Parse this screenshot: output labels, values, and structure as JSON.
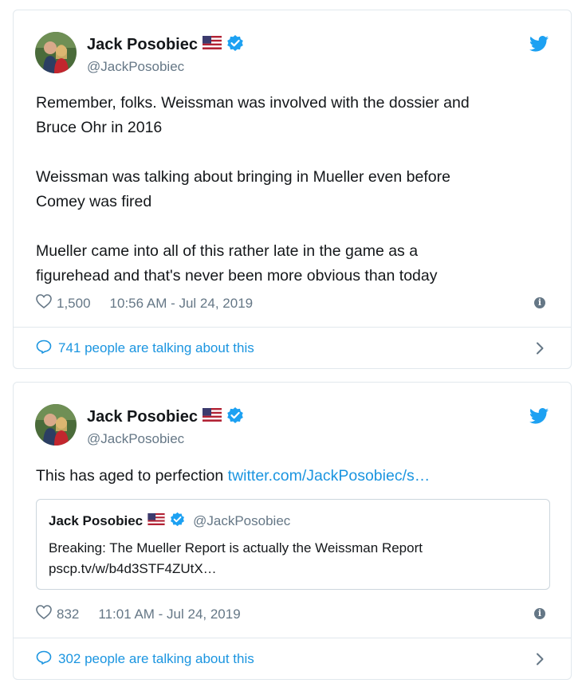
{
  "colors": {
    "link": "#1b95e0",
    "secondary_text": "#657786",
    "border": "#e1e8ed",
    "twitter_blue": "#1da1f2"
  },
  "tweets": [
    {
      "author_name": "Jack Posobiec",
      "author_handle": "@JackPosobiec",
      "flag_icon": "us-flag-icon",
      "verified_icon": "verified-badge-icon",
      "brand_icon": "twitter-bird-icon",
      "text_paragraphs": [
        [
          "Remember, folks. Weissman was involved with the dossier and",
          "Bruce Ohr in 2016"
        ],
        [
          "Weissman was talking about bringing in Mueller even before",
          "Comey was fired"
        ],
        [
          "Mueller came into all of this rather late in the game as a",
          "figurehead and that's never been more obvious than today"
        ]
      ],
      "likes": "1,500",
      "timestamp": "10:56 AM - Jul 24, 2019",
      "talking": "741 people are talking about this"
    },
    {
      "author_name": "Jack Posobiec",
      "author_handle": "@JackPosobiec",
      "flag_icon": "us-flag-icon",
      "verified_icon": "verified-badge-icon",
      "brand_icon": "twitter-bird-icon",
      "text": "This has aged to perfection ",
      "link_text": "twitter.com/JackPosobiec/s…",
      "quote": {
        "author_name": "Jack Posobiec",
        "author_handle": "@JackPosobiec",
        "text_line1": "Breaking: The Mueller Report is actually the Weissman Report",
        "text_line2": "pscp.tv/w/b4d3STF4ZUtX…"
      },
      "likes": "832",
      "timestamp": "11:01 AM - Jul 24, 2019",
      "talking": "302 people are talking about this"
    }
  ]
}
